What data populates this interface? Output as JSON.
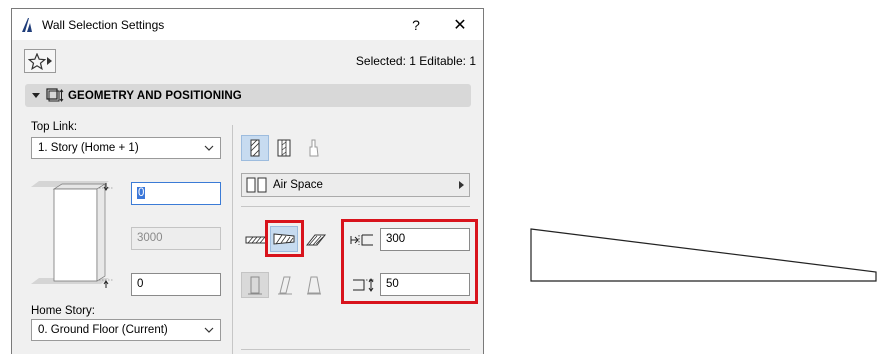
{
  "dialog": {
    "title": "Wall Selection Settings",
    "help_label": "?",
    "close_label": "✕",
    "selection_info": "Selected: 1 Editable: 1"
  },
  "section": {
    "label": "GEOMETRY AND POSITIONING"
  },
  "left": {
    "top_link_label": "Top Link:",
    "top_link_value": "1. Story (Home + 1)",
    "top_offset_value": "0",
    "height_value": "3000",
    "bottom_offset_value": "0",
    "home_story_label": "Home Story:",
    "home_story_value": "0. Ground Floor (Current)"
  },
  "right": {
    "composite_label": "Air Space",
    "thickness_value": "300",
    "thickness_end_value": "50"
  },
  "colors": {
    "highlight": "#d8131c",
    "selected_button": "#c7dbf0"
  }
}
